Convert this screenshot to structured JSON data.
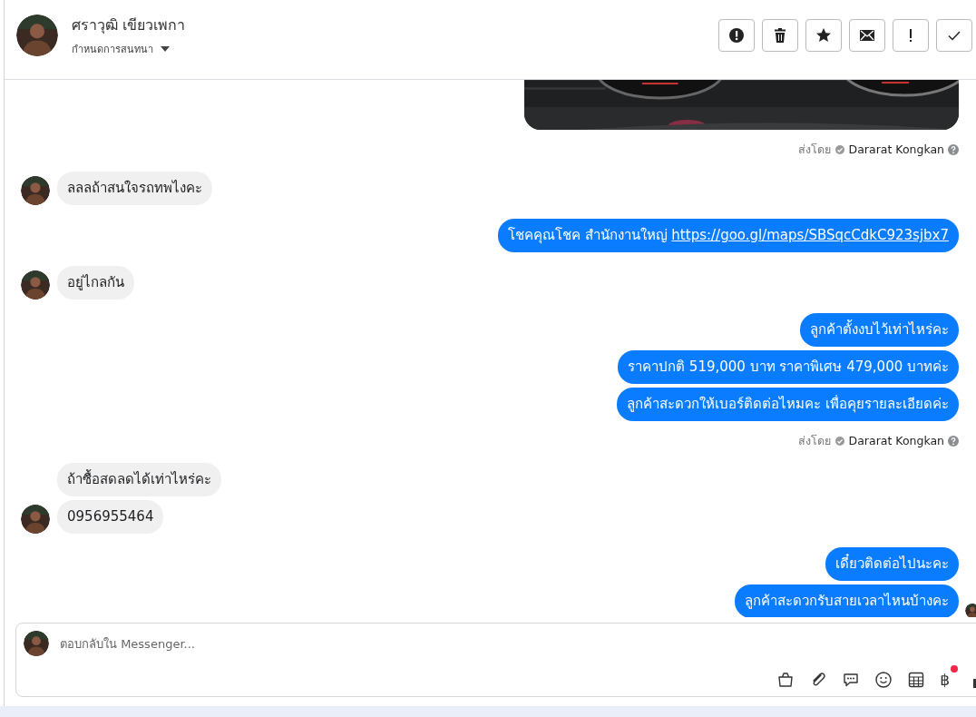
{
  "header": {
    "name": "ศราวุฒิ เขียวเพกา",
    "subtitle": "กำหนดการสนทนา",
    "actions": [
      {
        "kind": "alert"
      },
      {
        "kind": "trash"
      },
      {
        "kind": "star"
      },
      {
        "kind": "mail"
      },
      {
        "kind": "exclaim"
      },
      {
        "kind": "check"
      }
    ]
  },
  "messages": [
    {
      "kind": "outgoing",
      "sent_by": {
        "label": "ส่งโดย",
        "name": "Dararat Kongkan"
      }
    },
    {
      "kind": "incoming",
      "items": [
        {
          "kind": "text",
          "text": "ลลลถ้าสนใจรถทพไงคะ"
        }
      ]
    },
    {
      "kind": "outgoing",
      "items": [
        {
          "kind": "link",
          "text": "โชคคุณโชค สำนักงานใหญ่",
          "link": "https://goo.gl/maps/SBSqcCdkC923sjbx7"
        }
      ]
    },
    {
      "kind": "incoming",
      "items": [
        {
          "kind": "text",
          "text": "อยู่ไกลกัน"
        }
      ]
    },
    {
      "kind": "outgoing",
      "items": [
        {
          "kind": "text",
          "text": "ลูกค้าตั้งงบไว้เท่าไหร่คะ"
        },
        {
          "kind": "text",
          "text": "ราคาปกติ 519,000 บาท ราคาพิเศษ 479,000 บาทค่ะ"
        },
        {
          "kind": "text",
          "text": "ลูกค้าสะดวกให้เบอร์ติดต่อไหมคะ เพื่อคุยรายละเอียดค่ะ"
        }
      ],
      "sent_by": {
        "label": "ส่งโดย",
        "name": "Dararat Kongkan"
      }
    },
    {
      "kind": "incoming",
      "items": [
        {
          "kind": "text",
          "text": "ถ้าซื้อสดลดได้เท่าไหร่คะ"
        },
        {
          "kind": "text",
          "text": "0956955464"
        }
      ]
    },
    {
      "kind": "outgoing",
      "seen": true,
      "items": [
        {
          "kind": "text",
          "text": "เดี๋ยวติดต่อไปนะคะ"
        },
        {
          "kind": "text",
          "text": "ลูกค้าสะดวกรับสายเวลาไหนบ้างคะ"
        }
      ]
    }
  ],
  "composer": {
    "placeholder": "ตอบกลับใน Messenger...",
    "tools": [
      {
        "kind": "bag"
      },
      {
        "kind": "clip"
      },
      {
        "kind": "chat"
      },
      {
        "kind": "emoji"
      },
      {
        "kind": "table"
      },
      {
        "kind": "currency",
        "text": "฿",
        "badge": true
      },
      {
        "kind": "like"
      }
    ]
  }
}
